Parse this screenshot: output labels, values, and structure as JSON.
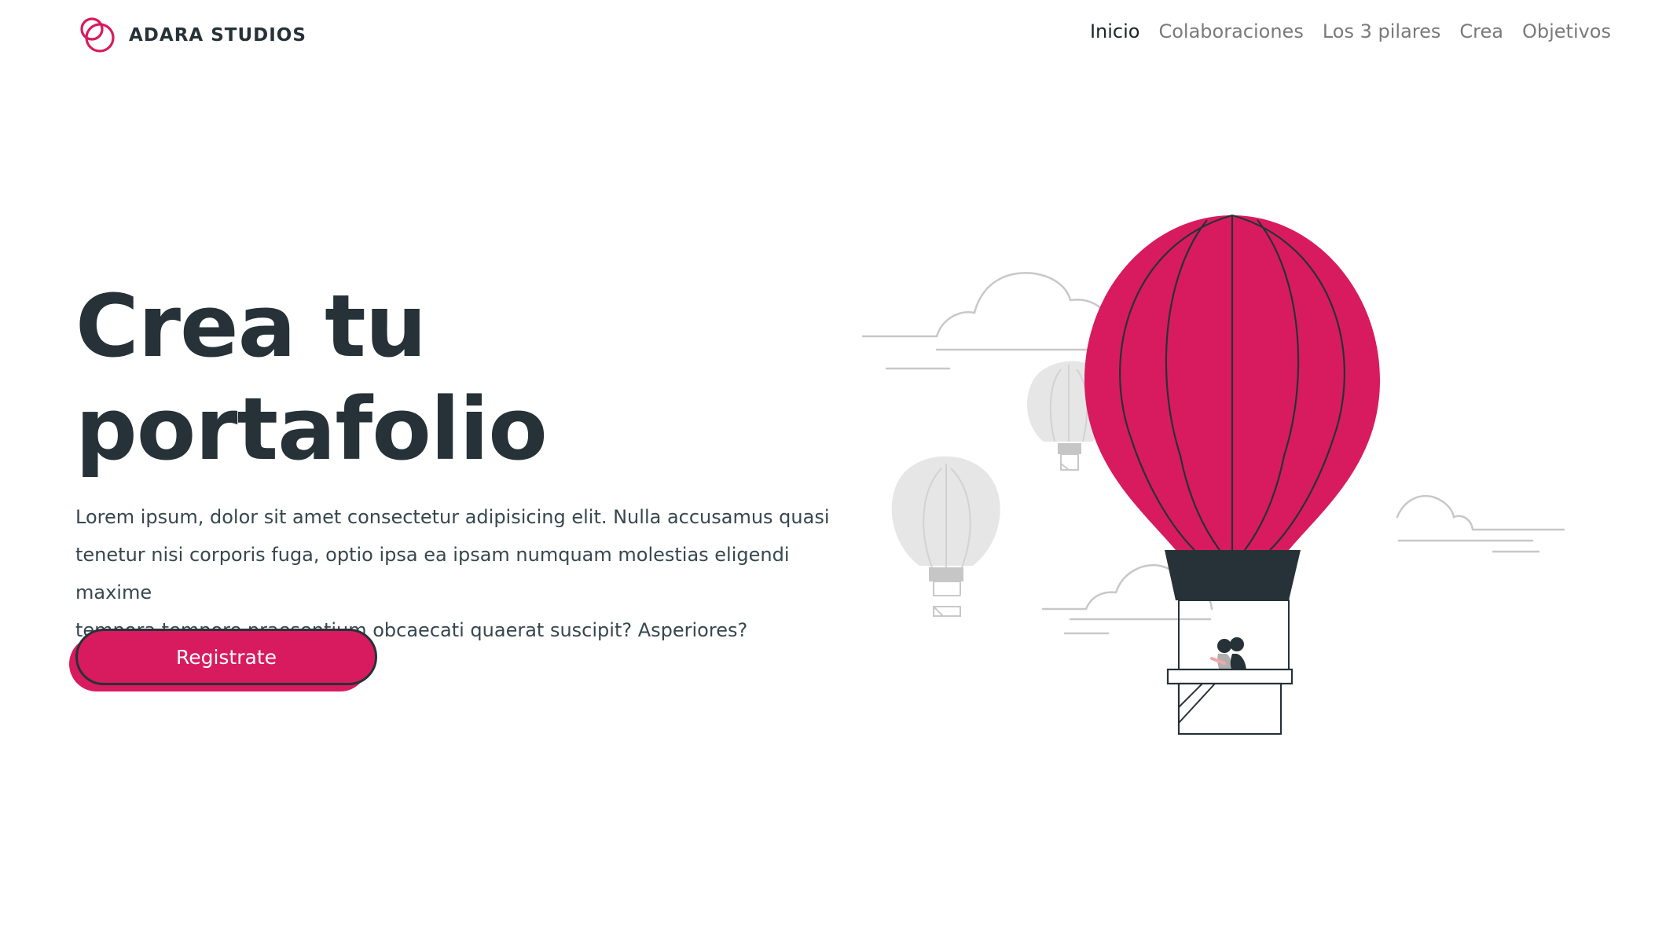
{
  "brand": {
    "name": "ADARA STUDIOS",
    "icon": "overlapping-circles-logo",
    "color": "#d81b5e"
  },
  "nav": {
    "items": [
      {
        "label": "Inicio",
        "active": true
      },
      {
        "label": "Colaboraciones",
        "active": false
      },
      {
        "label": "Los 3 pilares",
        "active": false
      },
      {
        "label": "Crea",
        "active": false
      },
      {
        "label": "Objetivos",
        "active": false
      }
    ]
  },
  "hero": {
    "title_line1": "Crea tu",
    "title_line2": "portafolio",
    "text_line1": "Lorem ipsum, dolor sit amet consectetur adipisicing elit. Nulla accusamus quasi",
    "text_line2": "tenetur nisi corporis fuga, optio ipsa ea ipsam numquam molestias eligendi maxime",
    "text_line3": "tempora tempore praesentium obcaecati quaerat suscipit? Asperiores?",
    "cta_label": "Registrate"
  },
  "illustration": {
    "subject": "hot-air-balloon-illustration",
    "accent": "#d81b5e",
    "dark": "#263238",
    "muted": "#e0e0e0"
  }
}
